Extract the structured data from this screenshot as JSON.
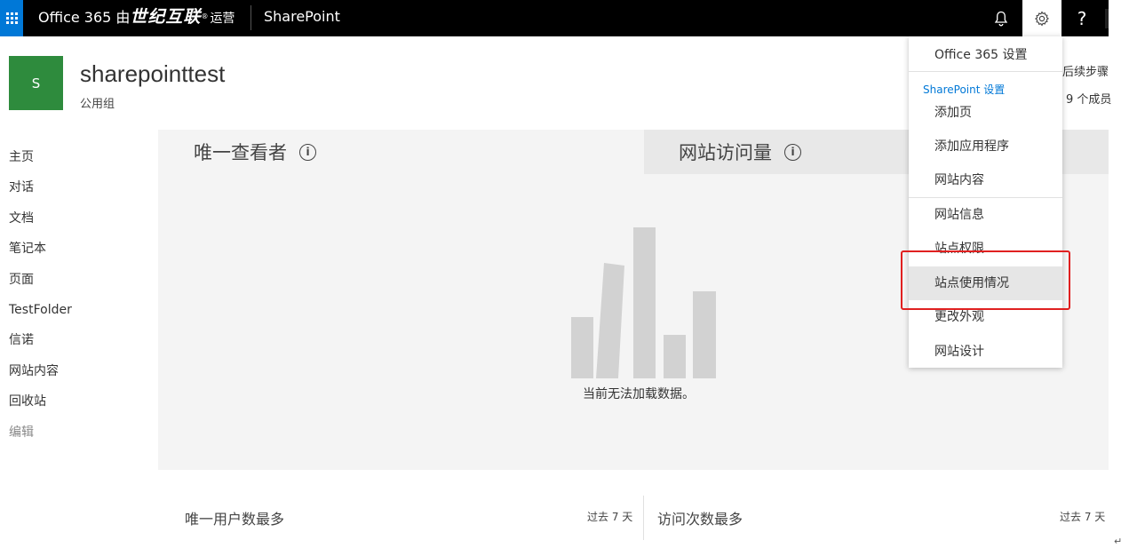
{
  "suite_bar": {
    "brand_prefix": "Office 365 由",
    "brand_partner": "世纪互联",
    "brand_reg": "®",
    "brand_suffix": "运营",
    "app_name": "SharePoint",
    "help_label": "?"
  },
  "site": {
    "logo_letter": "S",
    "title": "sharepointtest",
    "subtitle": "公用组",
    "right_clip_1": "后续步骤",
    "right_clip_2": "9 个成员"
  },
  "left_nav": {
    "items": [
      "主页",
      "对话",
      "文档",
      "笔记本",
      "页面",
      "TestFolder",
      "信诺",
      "网站内容",
      "回收站",
      "编辑"
    ]
  },
  "usage_panel": {
    "tab_unique_viewers": "唯一查看者",
    "tab_site_visits": "网站访问量",
    "info_glyph": "i",
    "no_data_message": "当前无法加载数据。"
  },
  "bottom": {
    "left_title": "唯一用户数最多",
    "left_range": "过去 7 天",
    "right_title": "访问次数最多",
    "right_range": "过去 7 天",
    "corner_mark": "↵"
  },
  "settings_menu": {
    "office_settings": "Office 365 设置",
    "sharepoint_group": "SharePoint 设置",
    "items": [
      "添加页",
      "添加应用程序",
      "网站内容",
      "网站信息",
      "站点权限",
      "站点使用情况",
      "更改外观",
      "网站设计"
    ],
    "hovered_item": "站点使用情况"
  },
  "colors": {
    "suite_bar": "#000000",
    "waffle": "#0078d7",
    "site_logo": "#2e8b3d",
    "highlight_box": "#e02020",
    "accent_link": "#0078d7"
  },
  "icons": {
    "waffle": "app-launcher-icon",
    "bell": "notification-bell-icon",
    "gear": "settings-gear-icon",
    "help": "help-icon",
    "info": "info-icon",
    "placeholder_chart": "bar-chart-placeholder-icon"
  }
}
